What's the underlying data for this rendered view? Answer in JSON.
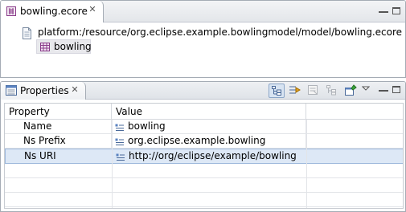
{
  "editor": {
    "tab_title": "bowling.ecore",
    "tree": {
      "root_label": "platform:/resource/org.eclipse.example.bowlingmodel/model/bowling.ecore",
      "child_label": "bowling"
    }
  },
  "properties": {
    "tab_title": "Properties",
    "columns": {
      "property": "Property",
      "value": "Value"
    },
    "rows": [
      {
        "property": "Name",
        "value": "bowling"
      },
      {
        "property": "Ns Prefix",
        "value": "org.eclipse.example.bowling"
      },
      {
        "property": "Ns URI",
        "value": "http://org/eclipse/example/bowling"
      }
    ],
    "selected_row": 2,
    "toolbar_icons": [
      "show-categories-icon",
      "show-advanced-icon",
      "filter-icon",
      "collapse-icon",
      "pin-icon",
      "view-menu-icon"
    ]
  },
  "colors": {
    "selection": "#dde8f6",
    "selection_border": "#9db8dc",
    "tab_border": "#a5acb5",
    "icon_purple": "#8a3c8a"
  }
}
